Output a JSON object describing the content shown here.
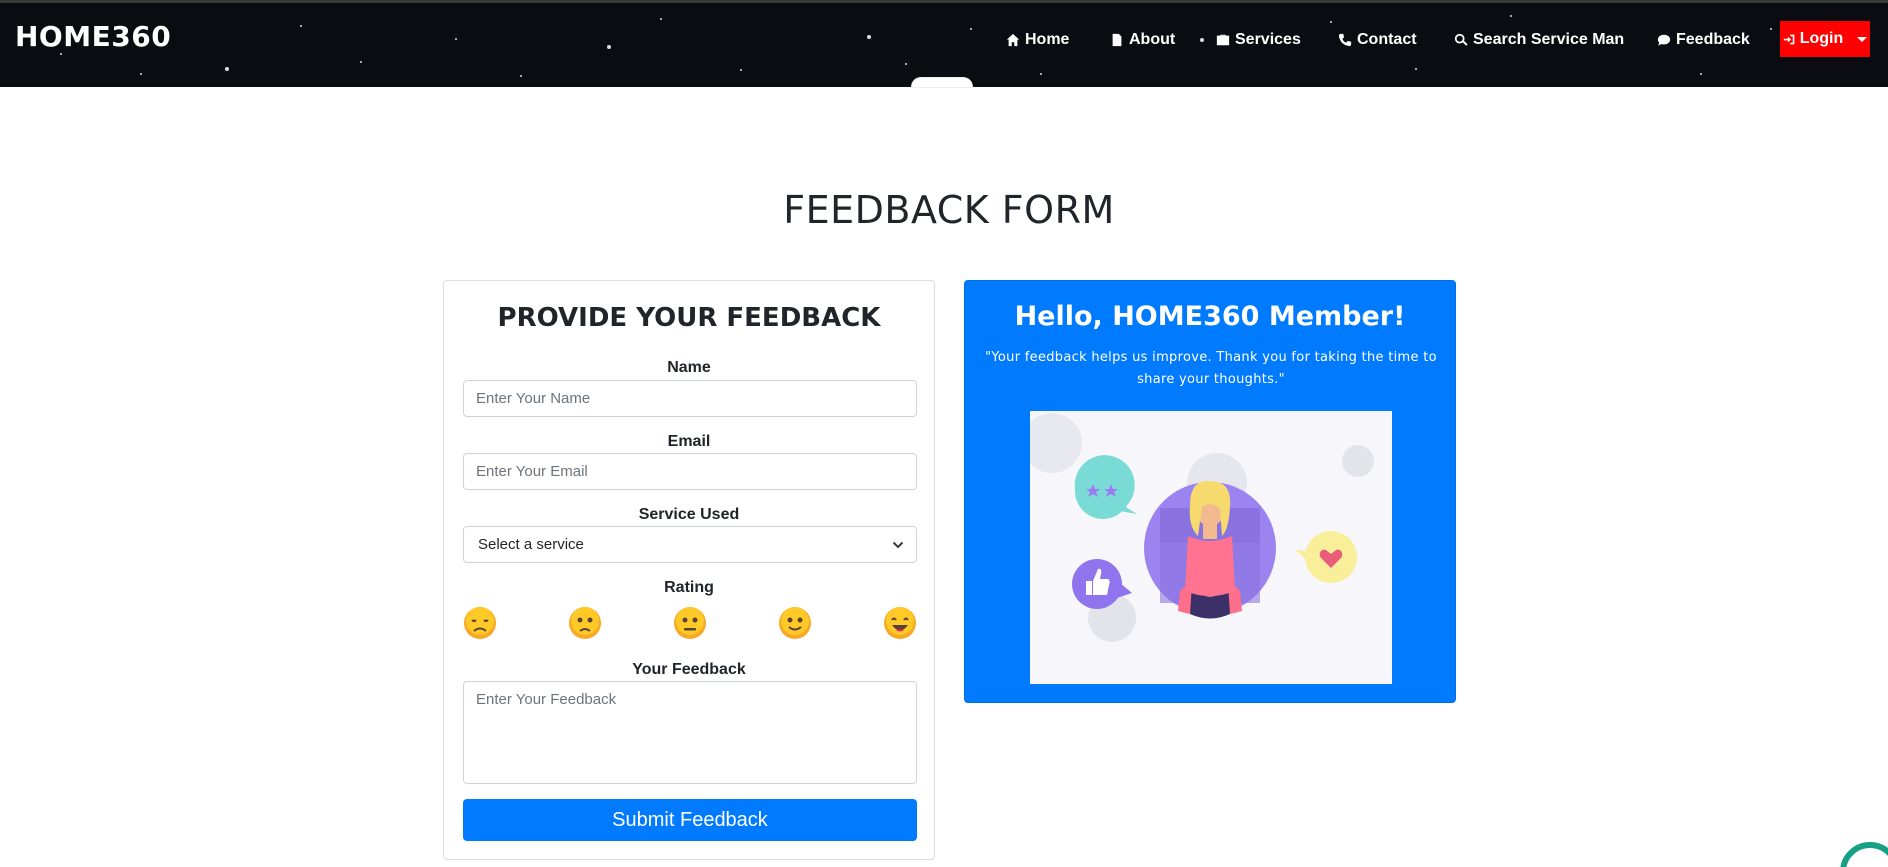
{
  "navbar": {
    "brand": "HOME360",
    "items": [
      {
        "label": "Home",
        "icon": "home-icon"
      },
      {
        "label": "About",
        "icon": "file-icon"
      },
      {
        "label": "Services",
        "icon": "briefcase-icon"
      },
      {
        "label": "Contact",
        "icon": "phone-icon"
      },
      {
        "label": "Search Service Man",
        "icon": "search-icon"
      },
      {
        "label": "Feedback",
        "icon": "comment-icon"
      }
    ],
    "login": {
      "label": "Login",
      "icon": "sign-in-icon",
      "color": "#ff0000"
    }
  },
  "page": {
    "title": "FEEDBACK FORM"
  },
  "form": {
    "title": "PROVIDE YOUR FEEDBACK",
    "name": {
      "label": "Name",
      "placeholder": "Enter Your Name"
    },
    "email": {
      "label": "Email",
      "placeholder": "Enter Your Email"
    },
    "service": {
      "label": "Service Used",
      "selected": "Select a service"
    },
    "rating": {
      "label": "Rating",
      "options": [
        "very-sad-emoji",
        "sad-emoji",
        "neutral-emoji",
        "happy-emoji",
        "very-happy-emoji"
      ]
    },
    "feedback": {
      "label": "Your Feedback",
      "placeholder": "Enter Your Feedback"
    },
    "submit_label": "Submit Feedback",
    "accent": "#007bff"
  },
  "info": {
    "title": "Hello, HOME360 Member!",
    "quote": "\"Your feedback helps us improve. Thank you for taking the time to share your thoughts.\"",
    "bg_color": "#007bff",
    "illustration": "feedback-illustration"
  }
}
